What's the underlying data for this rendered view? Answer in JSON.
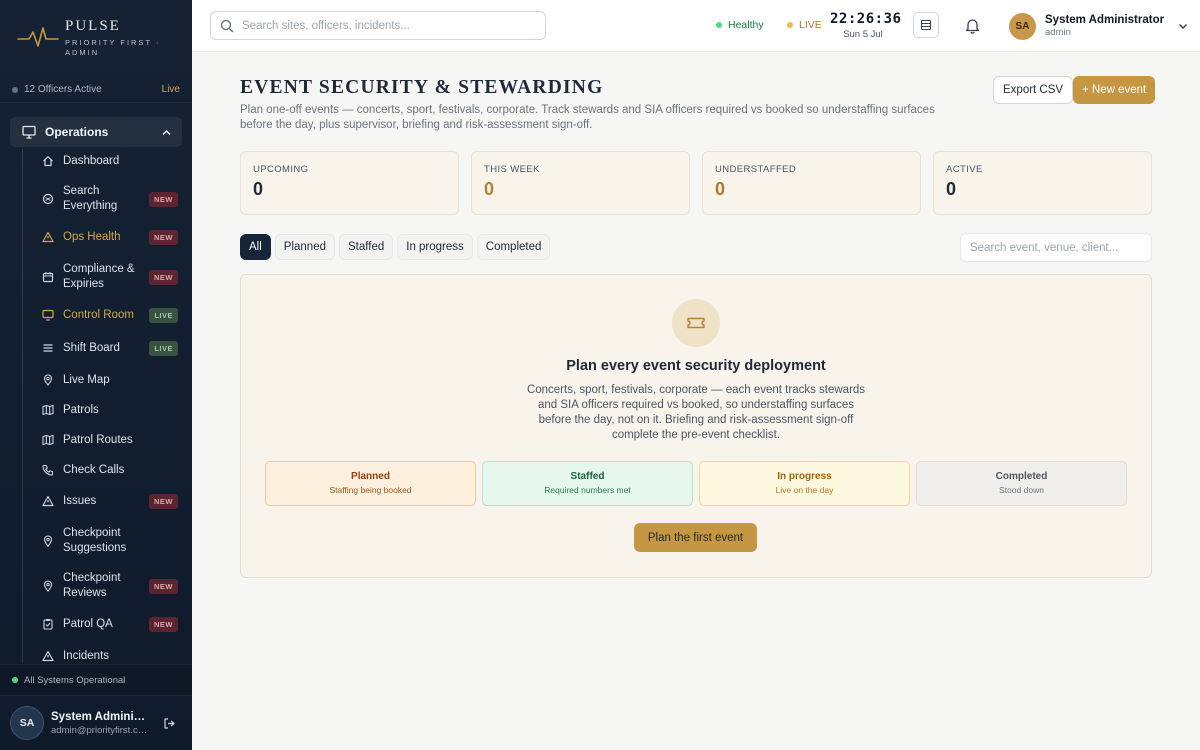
{
  "brand": {
    "name": "PULSE",
    "subtitle_line1": "PRIORITY FIRST ·",
    "subtitle_line2": "ADMIN"
  },
  "sidebar": {
    "officers_active": "12 Officers Active",
    "live_label": "Live",
    "section_label": "Operations",
    "items": [
      {
        "label": "Dashboard",
        "icon": "home-icon"
      },
      {
        "label": "Search Everything",
        "icon": "search-circle-icon",
        "badge": "NEW"
      },
      {
        "label": "Ops Health",
        "icon": "warning-icon",
        "badge": "NEW"
      },
      {
        "label": "Compliance & Expiries",
        "icon": "calendar-icon",
        "badge": "NEW"
      },
      {
        "label": "Control Room",
        "icon": "monitor-icon",
        "badge": "LIVE"
      },
      {
        "label": "Shift Board",
        "icon": "list-icon",
        "badge": "LIVE"
      },
      {
        "label": "Live Map",
        "icon": "map-pin-icon"
      },
      {
        "label": "Patrols",
        "icon": "map-icon"
      },
      {
        "label": "Patrol Routes",
        "icon": "map-icon"
      },
      {
        "label": "Check Calls",
        "icon": "phone-icon"
      },
      {
        "label": "Issues",
        "icon": "warning-icon",
        "badge": "NEW"
      },
      {
        "label": "Checkpoint Suggestions",
        "icon": "map-pin-icon"
      },
      {
        "label": "Checkpoint Reviews",
        "icon": "map-pin-icon",
        "badge": "NEW"
      },
      {
        "label": "Patrol QA",
        "icon": "clipboard-icon",
        "badge": "NEW"
      },
      {
        "label": "Incidents",
        "icon": "warning-icon"
      }
    ],
    "system_status": "All Systems Operational",
    "user": {
      "initials": "SA",
      "name": "System Administrator",
      "email": "admin@priorityfirst.co.uk"
    }
  },
  "topbar": {
    "search_placeholder": "Search sites, officers, incidents...",
    "health": "Healthy",
    "live": "LIVE",
    "time": "22:26:36",
    "date": "Sun 5 Jul",
    "profile": {
      "initials": "SA",
      "name": "System Administrator",
      "role": "admin"
    }
  },
  "page": {
    "title": "EVENT SECURITY & STEWARDING",
    "description": "Plan one-off events — concerts, sport, festivals, corporate. Track stewards and SIA officers required vs booked so understaffing surfaces before the day, plus supervisor, briefing and risk-assessment sign-off.",
    "export_label": "Export CSV",
    "new_event_label": "+ New event",
    "stats": [
      {
        "label": "UPCOMING",
        "value": "0"
      },
      {
        "label": "THIS WEEK",
        "value": "0"
      },
      {
        "label": "UNDERSTAFFED",
        "value": "0"
      },
      {
        "label": "ACTIVE",
        "value": "0"
      }
    ],
    "filters": [
      "All",
      "Planned",
      "Staffed",
      "In progress",
      "Completed"
    ],
    "active_filter": "All",
    "filter_search_placeholder": "Search event, venue, client...",
    "empty": {
      "title": "Plan every event security deployment",
      "description": "Concerts, sport, festivals, corporate — each event tracks stewards and SIA officers required vs booked, so understaffing surfaces before the day, not on it. Briefing and risk-assessment sign-off complete the pre-event checklist.",
      "statuses": [
        {
          "title": "Planned",
          "sub": "Staffing being booked"
        },
        {
          "title": "Staffed",
          "sub": "Required numbers met"
        },
        {
          "title": "In progress",
          "sub": "Live on the day"
        },
        {
          "title": "Completed",
          "sub": "Stood down"
        }
      ],
      "cta": "Plan the first event"
    }
  },
  "colors": {
    "accent": "#c59742",
    "sidebar": "#152234",
    "healthy": "#16a34a",
    "live": "#f0b84d"
  }
}
